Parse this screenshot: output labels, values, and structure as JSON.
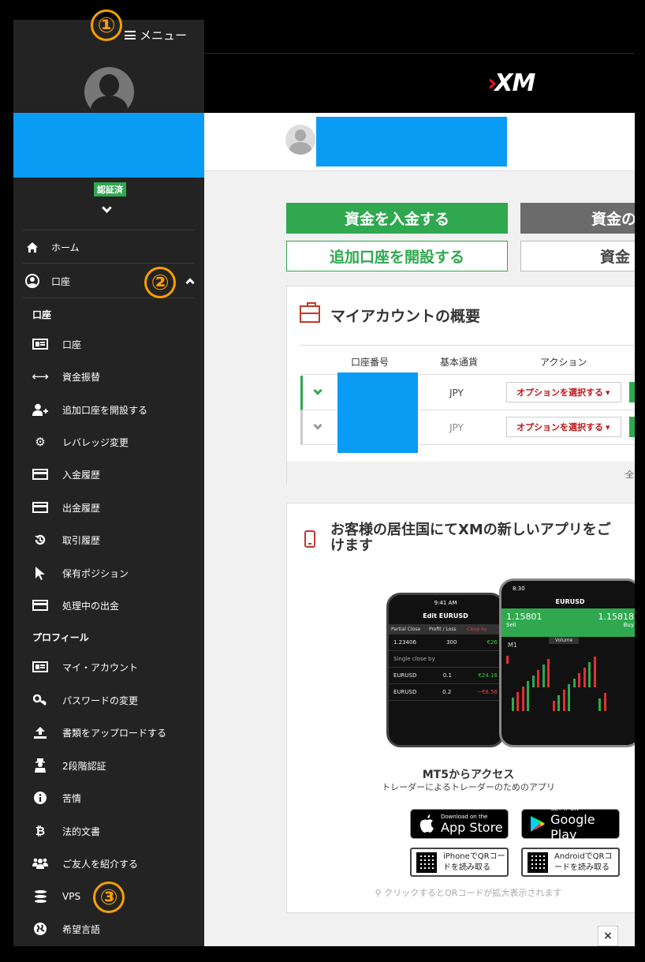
{
  "header": {
    "menu_label": "メニュー",
    "logo_text": "XM"
  },
  "annotations": {
    "one": "①",
    "two": "②",
    "three": "③"
  },
  "sidebar": {
    "verified_badge": "認証済",
    "home": "ホーム",
    "account_group": "口座",
    "section_account": "口座",
    "account_items": [
      {
        "label": "口座",
        "icon": "id-card-icon"
      },
      {
        "label": "資金振替",
        "icon": "arrows-horizontal-icon"
      },
      {
        "label": "追加口座を開設する",
        "icon": "add-user-icon"
      },
      {
        "label": "レバレッジ変更",
        "icon": "gear-icon"
      },
      {
        "label": "入金履歴",
        "icon": "credit-card-icon"
      },
      {
        "label": "出金履歴",
        "icon": "credit-card-icon"
      },
      {
        "label": "取引履歴",
        "icon": "history-icon"
      },
      {
        "label": "保有ポジション",
        "icon": "cursor-icon"
      },
      {
        "label": "処理中の出金",
        "icon": "credit-card-icon"
      }
    ],
    "section_profile": "プロフィール",
    "profile_items": [
      {
        "label": "マイ・アカウント",
        "icon": "id-card-icon"
      },
      {
        "label": "パスワードの変更",
        "icon": "key-icon"
      },
      {
        "label": "書類をアップロードする",
        "icon": "upload-icon"
      },
      {
        "label": "2段階認証",
        "icon": "agent-icon"
      },
      {
        "label": "苦情",
        "icon": "info-icon"
      },
      {
        "label": "法的文書",
        "icon": "bitcoin-icon"
      },
      {
        "label": "ご友人を紹介する",
        "icon": "users-icon"
      },
      {
        "label": "VPS",
        "icon": "database-icon"
      },
      {
        "label": "希望言語",
        "icon": "globe-icon"
      }
    ]
  },
  "actions": {
    "deposit": "資金を入金する",
    "withdraw": "資金の",
    "open_account": "追加口座を開設する",
    "transfer": "資金"
  },
  "accounts": {
    "title": "マイアカウントの概要",
    "columns": [
      "口座番号",
      "基本通貨",
      "アクション"
    ],
    "rows": [
      {
        "currency": "JPY",
        "action": "オプションを選択する"
      },
      {
        "currency": "JPY",
        "action": "オプションを選択する"
      }
    ],
    "footer_text": "全"
  },
  "app_promo": {
    "title_line1": "お客様の居住国にてXMの新しいアプリをご",
    "title_line2": "けます",
    "heading": "MT5からアクセス",
    "subheading": "トレーダーによるトレーダーのためのアプリ",
    "appstore_small": "Download on the",
    "appstore_big": "App Store",
    "googleplay_small": "GET IT ON",
    "googleplay_big": "Google Play",
    "qr_iphone_line1": "iPhoneでQRコー",
    "qr_iphone_line2": "ドを読み取る",
    "qr_android_line1": "AndroidでQRコ",
    "qr_android_line2": "ードを読み取る",
    "qr_note": "クリックするとQRコードが拡大表示されます"
  },
  "phone_back": {
    "time": "9:41 AM",
    "title": "Edit EURUSD",
    "tabs": [
      "Partial Close",
      "Profit / Loss",
      "Close by"
    ],
    "values": [
      "1.23406",
      "300",
      "€26"
    ],
    "single_close": "Single close by",
    "trades": [
      {
        "symbol": "EURUSD",
        "lots": "0.1",
        "pnl": "€24.16"
      },
      {
        "symbol": "EURUSD",
        "lots": "0.2",
        "pnl": "−€8.56"
      }
    ]
  },
  "phone_front": {
    "time": "8:30",
    "symbol": "EURUSD",
    "sell_price": "1.15801",
    "sell_label": "Sell",
    "buy_price": "1.15818",
    "buy_label": "Buy",
    "timeframe": "M1",
    "volume_label": "Volume"
  },
  "close_label": "×",
  "colors": {
    "accent_green": "#2fa84f",
    "brand_red": "#e3151a",
    "highlight_blue": "#0a9bf5",
    "annotation_orange": "#f5a000"
  }
}
